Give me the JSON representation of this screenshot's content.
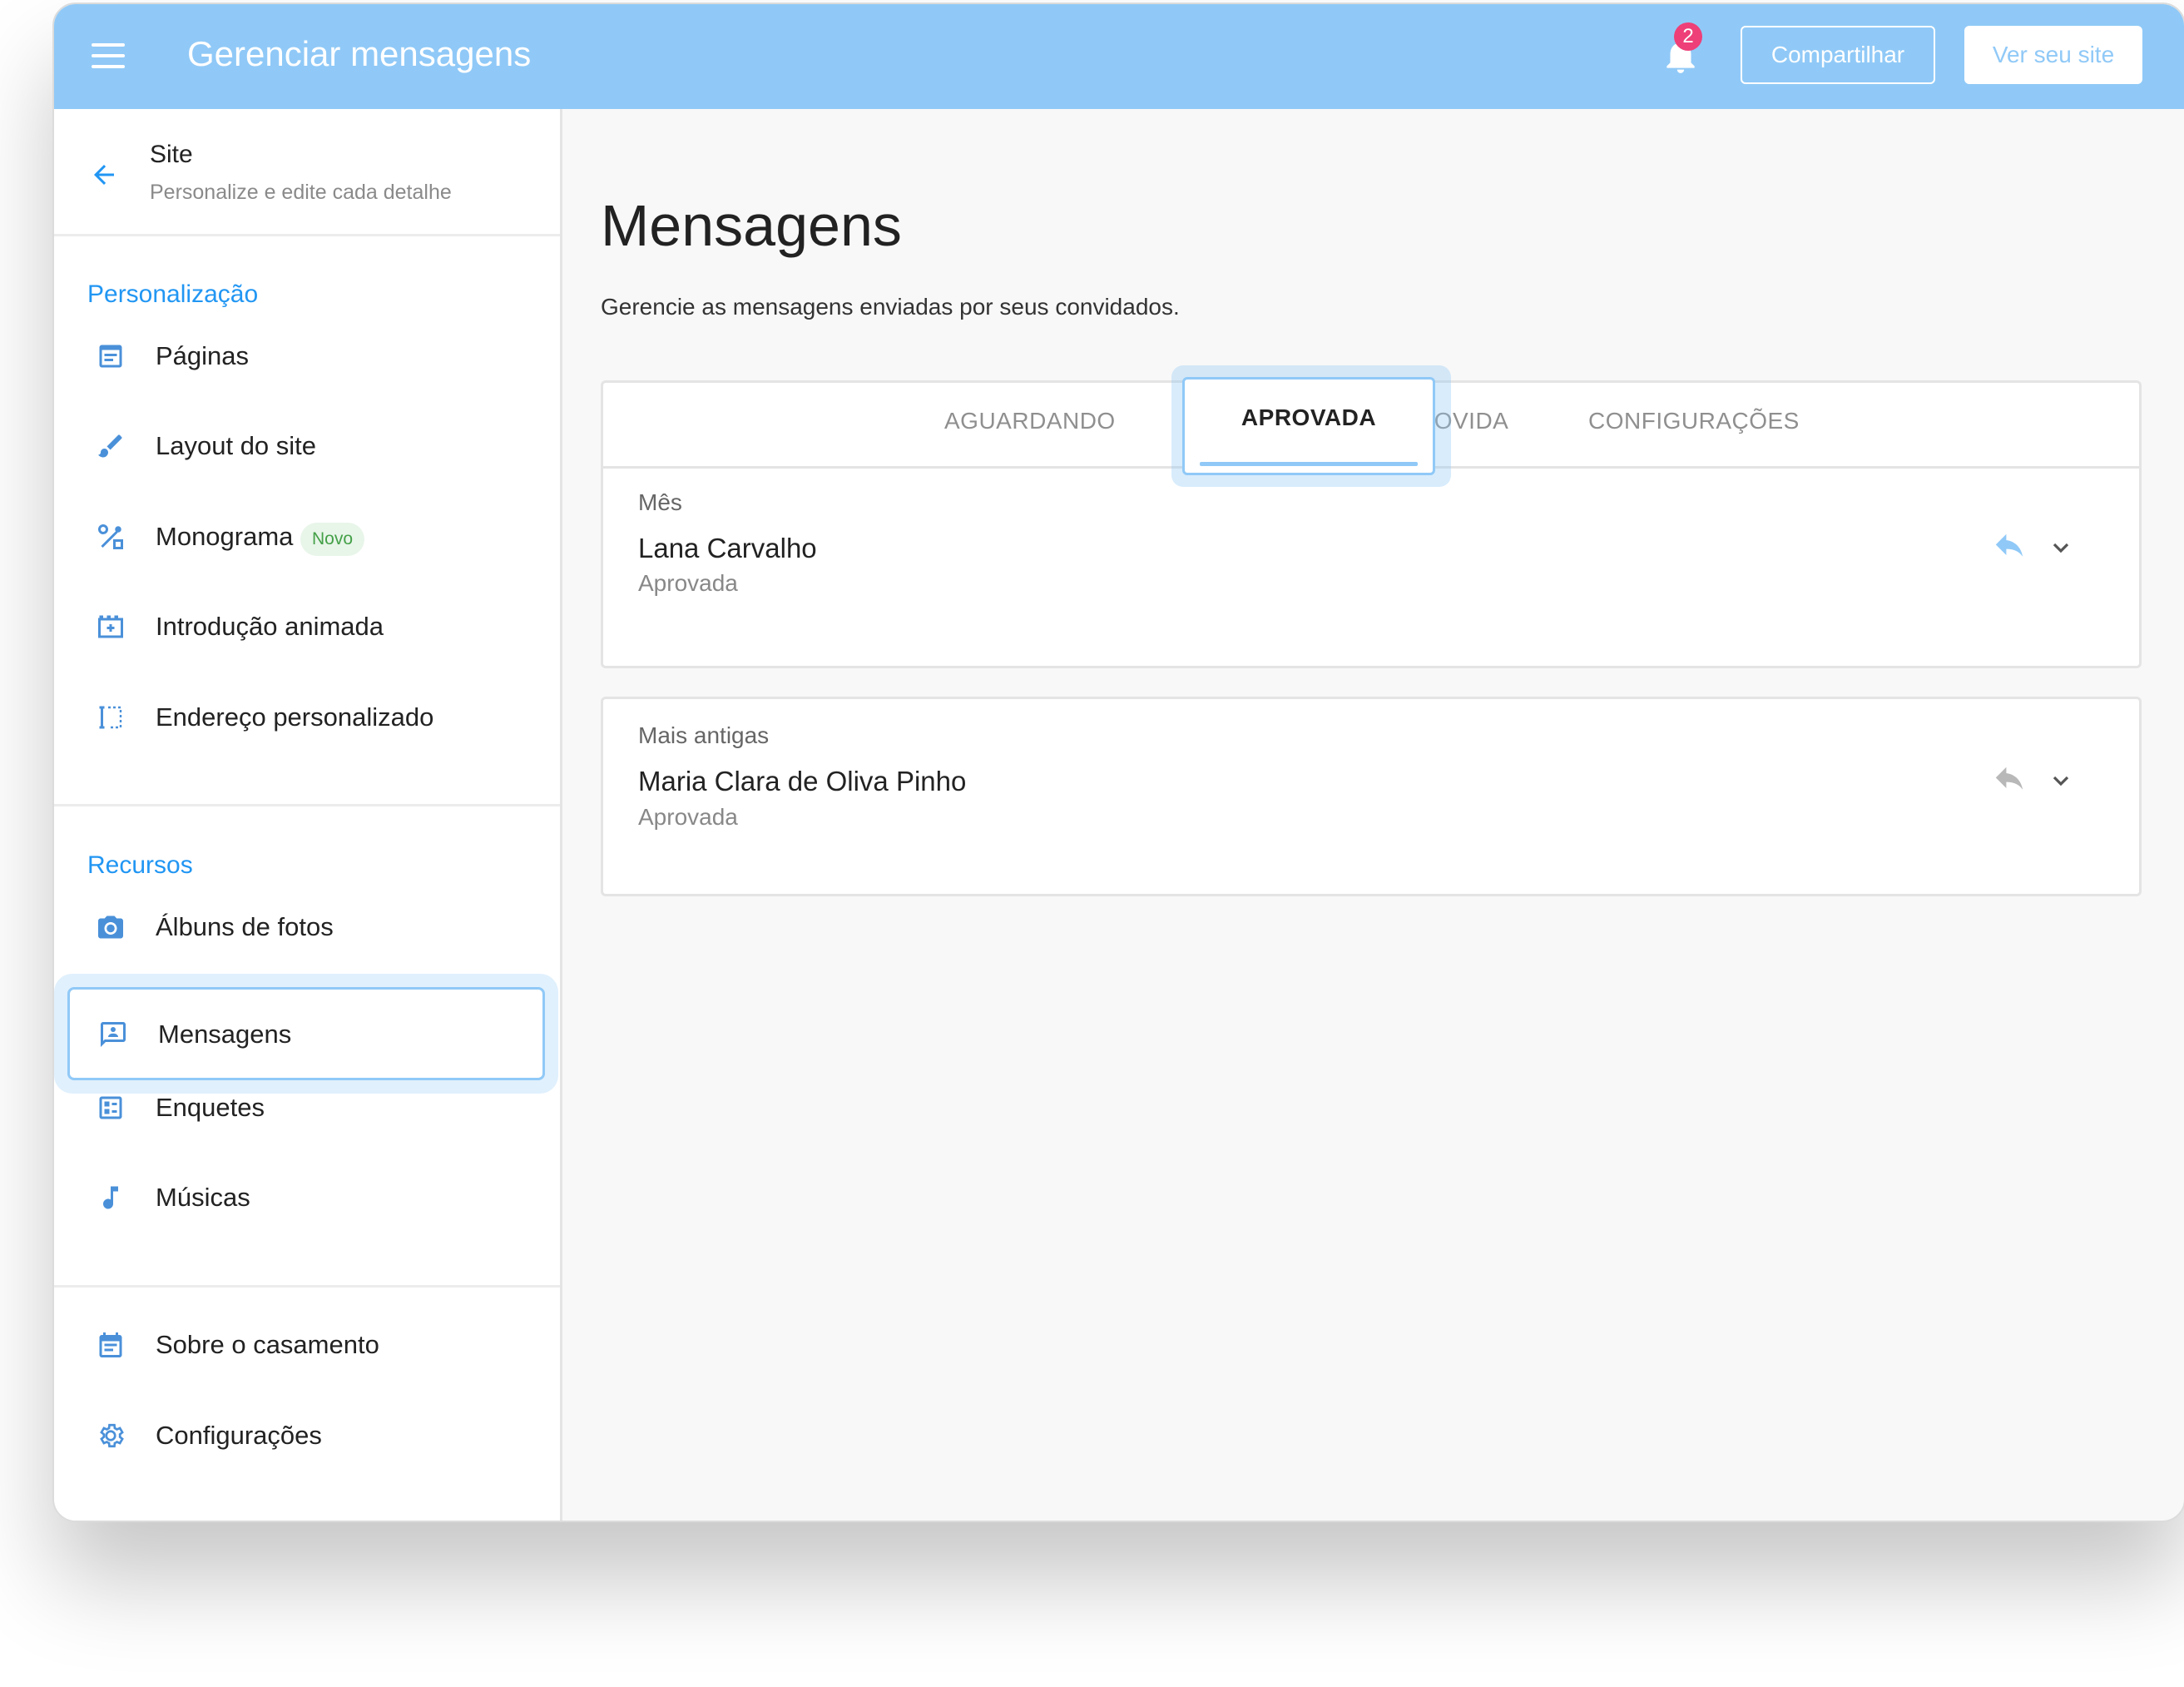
{
  "topbar": {
    "title": "Gerenciar mensagens",
    "notification_count": "2",
    "share_label": "Compartilhar",
    "view_site_label": "Ver seu site"
  },
  "sidebar": {
    "header": {
      "title": "Site",
      "subtitle": "Personalize e edite cada detalhe"
    },
    "sections": [
      {
        "label": "Personalização",
        "items": [
          {
            "label": "Páginas",
            "icon": "page-icon"
          },
          {
            "label": "Layout do site",
            "icon": "brush-icon"
          },
          {
            "label": "Monograma",
            "icon": "monogram-icon",
            "badge": "Novo"
          },
          {
            "label": "Introdução animada",
            "icon": "film-icon"
          },
          {
            "label": "Endereço personalizado",
            "icon": "address-icon"
          }
        ]
      },
      {
        "label": "Recursos",
        "items": [
          {
            "label": "Álbuns de fotos",
            "icon": "camera-icon"
          },
          {
            "label": "Mensagens",
            "icon": "message-icon",
            "active": true
          },
          {
            "label": "Enquetes",
            "icon": "poll-icon"
          },
          {
            "label": "Músicas",
            "icon": "music-icon"
          }
        ]
      },
      {
        "label": "",
        "items": [
          {
            "label": "Sobre o casamento",
            "icon": "calendar-icon"
          },
          {
            "label": "Configurações",
            "icon": "gear-icon"
          }
        ]
      }
    ]
  },
  "main": {
    "title": "Mensagens",
    "description": "Gerencie as mensagens enviadas por seus convidados.",
    "tabs": [
      {
        "label": "AGUARDANDO"
      },
      {
        "label": "APROVADA",
        "active": true
      },
      {
        "label": "REMOVIDA"
      },
      {
        "label": "CONFIGURAÇÕES"
      }
    ],
    "groups": [
      {
        "label": "Mês",
        "messages": [
          {
            "name": "Lana Carvalho",
            "status": "Aprovada"
          }
        ]
      },
      {
        "label": "Mais antigas",
        "messages": [
          {
            "name": "Maria Clara de Oliva Pinho",
            "status": "Aprovada"
          }
        ]
      }
    ]
  },
  "colors": {
    "accent": "#90c9f7",
    "link_blue": "#2196f3",
    "badge_pink": "#ee3f78",
    "novo_green": "#43a047"
  }
}
